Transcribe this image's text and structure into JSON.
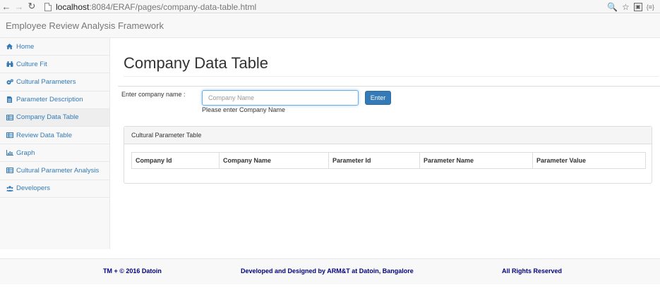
{
  "browser": {
    "url_host": "localhost",
    "url_rest": ":8084/ERAF/pages/company-data-table.html",
    "ext_label": "{≡}"
  },
  "header": {
    "brand": "Employee Review Analysis Framework"
  },
  "sidebar": {
    "items": [
      {
        "label": "Home",
        "icon": "home-icon"
      },
      {
        "label": "Culture Fit",
        "icon": "binoculars-icon"
      },
      {
        "label": "Cultural Parameters",
        "icon": "gears-icon"
      },
      {
        "label": "Parameter Description",
        "icon": "file-icon"
      },
      {
        "label": "Company Data Table",
        "icon": "table-icon"
      },
      {
        "label": "Review Data Table",
        "icon": "table-icon"
      },
      {
        "label": "Graph",
        "icon": "bar-chart-icon"
      },
      {
        "label": "Cultural Parameter Analysis",
        "icon": "table-icon"
      },
      {
        "label": "Developers",
        "icon": "users-icon"
      }
    ],
    "active_index": 4
  },
  "main": {
    "title": "Company Data Table",
    "form_label": "Enter company name :",
    "input_placeholder": "Company Name",
    "input_value": "",
    "enter_label": "Enter",
    "help_text": "Please enter Company Name",
    "panel_title": "Cultural Parameter Table",
    "table_headers": [
      "Company Id",
      "Company Name",
      "Parameter Id",
      "Parameter Name",
      "Parameter Value"
    ]
  },
  "footer": {
    "left": "TM + © 2016 Datoin",
    "center": "Developed and Designed by ARM&T at Datoin, Bangalore",
    "right": "All Rights Reserved"
  },
  "colors": {
    "link": "#337ab7",
    "primary_button": "#337ab7",
    "footer_text": "#000080"
  }
}
